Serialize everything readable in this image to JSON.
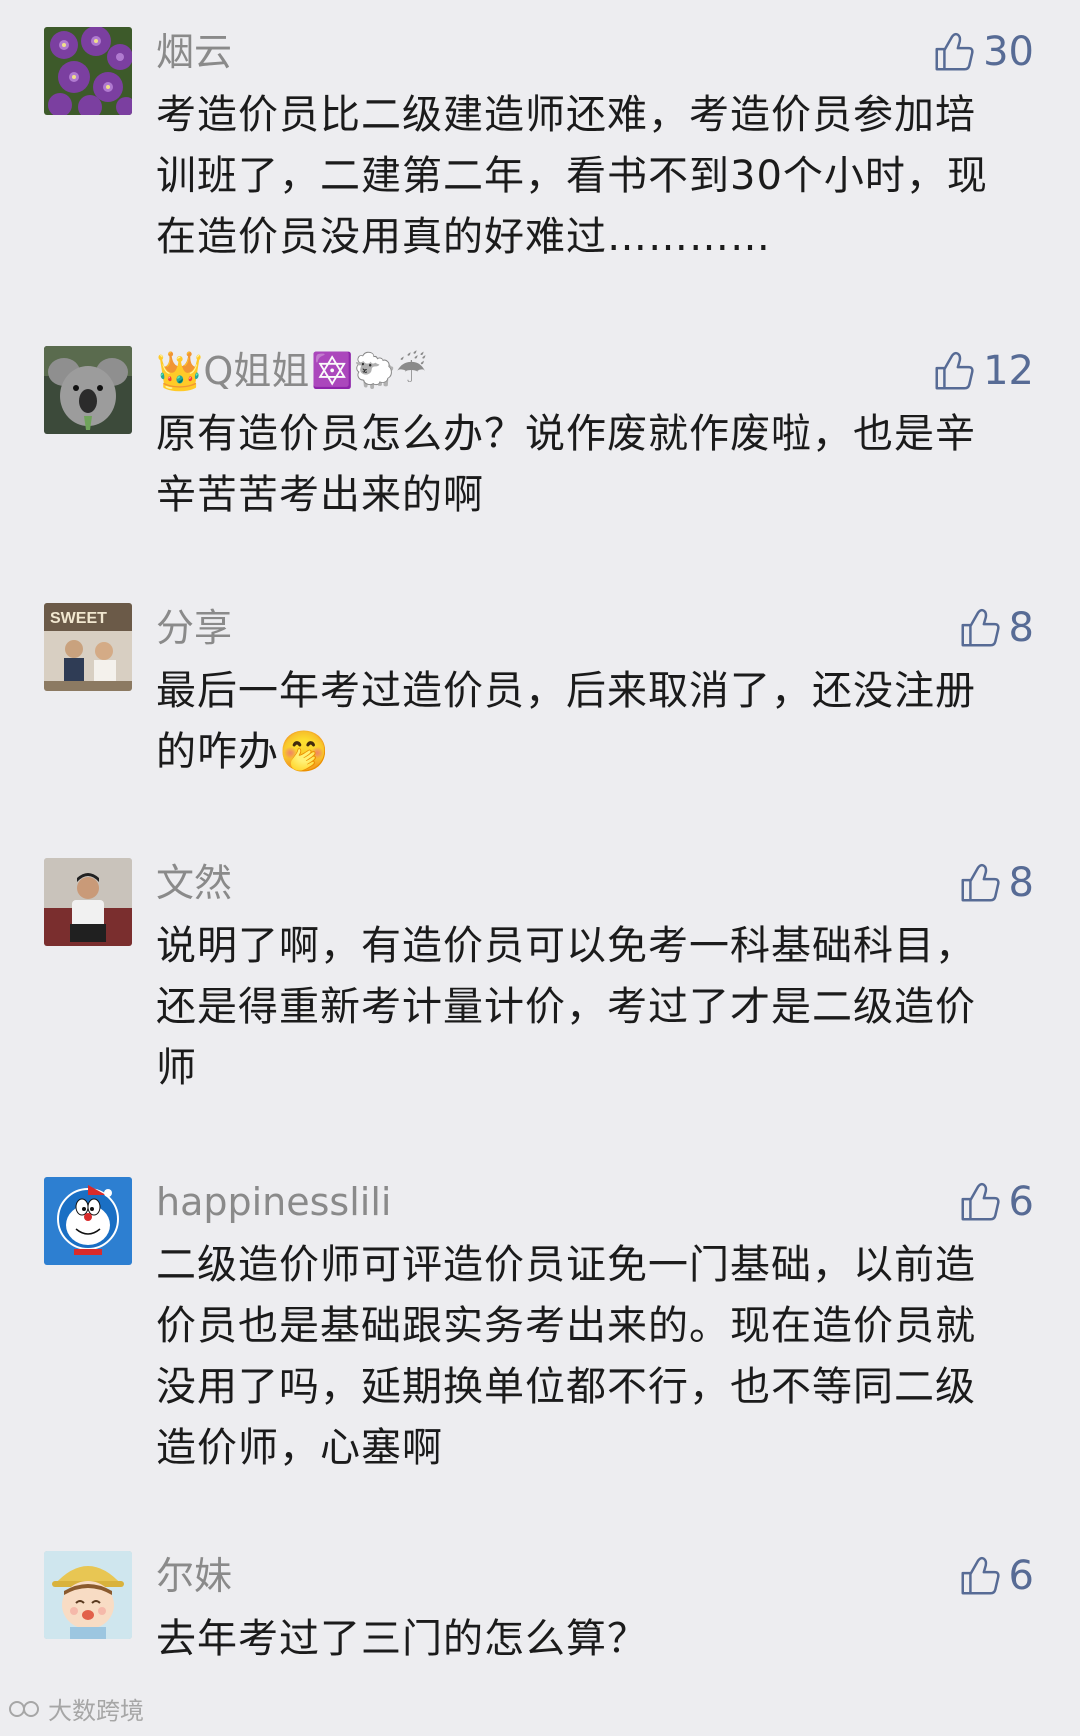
{
  "comments": [
    {
      "nickname": "烟云",
      "nickname_emoji": "",
      "likes": "30",
      "avatar": "purple-flowers-avatar",
      "text": "考造价员比二级建造师还难，考造价员参加培训班了，二建第二年，看书不到30个小时，现在造价员没用真的好难过…………"
    },
    {
      "nickname": "👑Q姐姐",
      "nickname_emoji": "🔯🐑☔",
      "likes": "12",
      "avatar": "koala-avatar",
      "text": "原有造价员怎么办？说作废就作废啦，也是辛辛苦苦考出来的啊"
    },
    {
      "nickname": "分享",
      "nickname_emoji": "",
      "likes": "8",
      "avatar": "couple-photo-avatar",
      "text": "最后一年考过造价员，后来取消了，还没注册的咋办🤭"
    },
    {
      "nickname": "文然",
      "nickname_emoji": "",
      "likes": "8",
      "avatar": "man-sitting-avatar",
      "text": "说明了啊，有造价员可以免考一科基础科目，还是得重新考计量计价，考过了才是二级造价师"
    },
    {
      "nickname": "happinesslili",
      "nickname_emoji": "",
      "likes": "6",
      "avatar": "doraemon-avatar",
      "text": "二级造价师可评造价员证免一门基础，以前造价员也是基础跟实务考出来的。现在造价员就没用了吗，延期换单位都不行，也不等同二级造价师，心塞啊"
    },
    {
      "nickname": "尔妹",
      "nickname_emoji": "",
      "likes": "6",
      "avatar": "cartoon-girl-avatar",
      "text": "去年考过了三门的怎么算？"
    }
  ],
  "watermark": "大数跨境",
  "colors": {
    "background": "#ededf0",
    "nickname": "#8a8a8a",
    "like_accent": "#576b95",
    "text": "#1b1b1b"
  },
  "icons": {
    "like": "thumbs-up-icon"
  }
}
